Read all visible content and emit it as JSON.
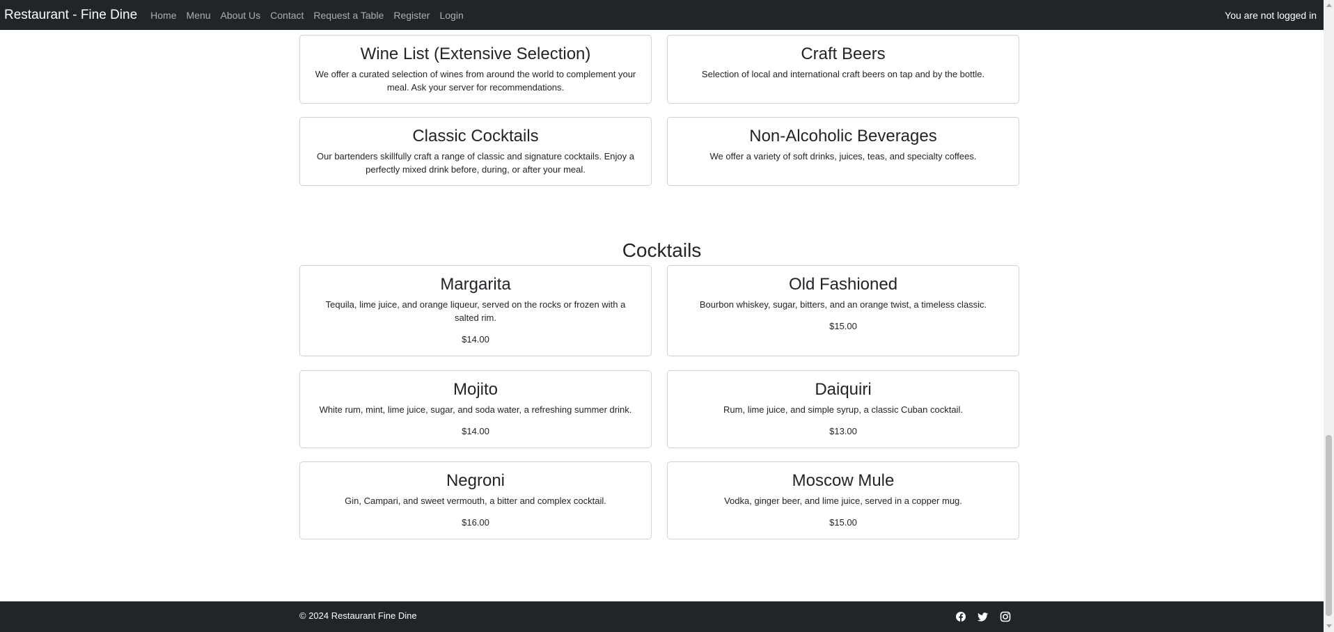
{
  "navbar": {
    "brand": "Restaurant - Fine Dine",
    "links": [
      "Home",
      "Menu",
      "About Us",
      "Contact",
      "Request a Table",
      "Register",
      "Login"
    ],
    "status": "You are not logged in"
  },
  "beverages": {
    "cards": [
      {
        "title": "Wine List (Extensive Selection)",
        "description": "We offer a curated selection of wines from around the world to complement your meal. Ask your server for recommendations."
      },
      {
        "title": "Craft Beers",
        "description": "Selection of local and international craft beers on tap and by the bottle."
      },
      {
        "title": "Classic Cocktails",
        "description": "Our bartenders skillfully craft a range of classic and signature cocktails. Enjoy a perfectly mixed drink before, during, or after your meal."
      },
      {
        "title": "Non-Alcoholic Beverages",
        "description": "We offer a variety of soft drinks, juices, teas, and specialty coffees."
      }
    ]
  },
  "cocktails": {
    "title": "Cocktails",
    "items": [
      {
        "name": "Margarita",
        "description": "Tequila, lime juice, and orange liqueur, served on the rocks or frozen with a salted rim.",
        "price": "$14.00"
      },
      {
        "name": "Old Fashioned",
        "description": "Bourbon whiskey, sugar, bitters, and an orange twist, a timeless classic.",
        "price": "$15.00"
      },
      {
        "name": "Mojito",
        "description": "White rum, mint, lime juice, sugar, and soda water, a refreshing summer drink.",
        "price": "$14.00"
      },
      {
        "name": "Daiquiri",
        "description": "Rum, lime juice, and simple syrup, a classic Cuban cocktail.",
        "price": "$13.00"
      },
      {
        "name": "Negroni",
        "description": "Gin, Campari, and sweet vermouth, a bitter and complex cocktail.",
        "price": "$16.00"
      },
      {
        "name": "Moscow Mule",
        "description": "Vodka, ginger beer, and lime juice, served in a copper mug.",
        "price": "$15.00"
      }
    ]
  },
  "footer": {
    "copyright": "© 2024 Restaurant Fine Dine",
    "social_icons": [
      "facebook-icon",
      "twitter-icon",
      "instagram-icon"
    ]
  },
  "colors": {
    "navbar_bg": "#212529",
    "nav_link": "#9fa1a3",
    "text": "#212529",
    "card_border": "#d1d2d3",
    "scrollbar_thumb": "#c1c1c1"
  }
}
